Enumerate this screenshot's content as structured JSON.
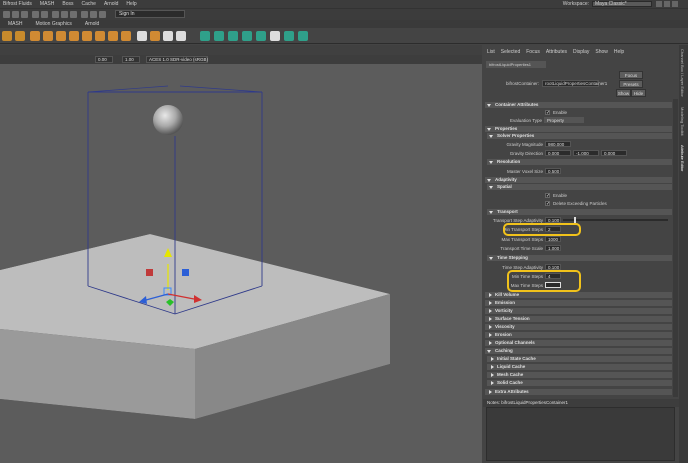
{
  "menubar": {
    "items": [
      "Bifrost Fluids",
      "MASH",
      "Boss",
      "Cache",
      "Arnold",
      "Help"
    ],
    "workspace_label": "Workspace:",
    "workspace_value": "Maya Classic*"
  },
  "statusline": {
    "signin": "Sign In"
  },
  "shelf": {
    "tabs": [
      "MASH",
      "Motion Graphics",
      "Arnold"
    ]
  },
  "viewport": {
    "field1": "0.00",
    "field2": "1.00",
    "colorspace": "ACES 1.0 SDR-video (sRGB)"
  },
  "ae": {
    "menu": [
      "List",
      "Selected",
      "Focus",
      "Attributes",
      "Display",
      "Show",
      "Help"
    ],
    "tab": "bifrostLiquidProperties1",
    "node_label": "bifrostContainer:",
    "node_value": "rootLiquidPropertiesContainer1",
    "focus": "Focus",
    "presets": "Presets",
    "show": "Show",
    "hide": "Hide",
    "container_attrs": "Container Attributes",
    "enable": "Enable",
    "eval_label": "Evaluation Type",
    "eval_value": "Property",
    "properties": "Properties",
    "solver_props": "Solver Properties",
    "gravity_mag_label": "Gravity Magnitude",
    "gravity_mag": "980.000",
    "gravity_dir_label": "Gravity Direction",
    "gravity_dir": [
      "0.000",
      "-1.000",
      "0.000"
    ],
    "resolution": "Resolution",
    "voxel_label": "Master Voxel Size",
    "voxel": "0.500",
    "adaptivity": "Adaptivity",
    "spatial": "Spatial",
    "enable2": "Enable",
    "delete_exceeding": "Delete Exceeding Particles",
    "transport": "Transport",
    "tsa_label": "Transport Step Adaptivity",
    "tsa": "0.100",
    "tsa_fill": 0.1,
    "mints_label": "Min Transport Steps",
    "mints": "2",
    "maxts_label": "Max Transport Steps",
    "maxts": "1000",
    "tts_label": "Transport Time Scale",
    "tts": "1.000",
    "time_stepping": "Time Stepping",
    "tstep_label": "Time Step Adaptivity",
    "tstep": "0.100",
    "mintime_label": "Min Time Steps",
    "mintime": "4",
    "maxtime_label": "Max Time Steps",
    "maxtime": "",
    "collapsed": [
      "Kill Volume",
      "Emission",
      "Vorticity",
      "Surface Tension",
      "Viscosity",
      "Erosion",
      "Optional Channels",
      "Caching"
    ],
    "caching_sub": [
      "Initial State Cache",
      "Liquid Cache",
      "Mesh Cache",
      "Solid Cache"
    ],
    "extra": "Extra Attributes",
    "notes": "Notes: bifrostLiquidPropertiesContainer1"
  },
  "side_tabs": [
    "Channel Box / Layer Editor",
    "Modeling Toolkit",
    "Attribute Editor"
  ],
  "colors": {
    "highlight": "#f1c21b",
    "panel": "#444444",
    "viewport": "#5c5c5c"
  }
}
